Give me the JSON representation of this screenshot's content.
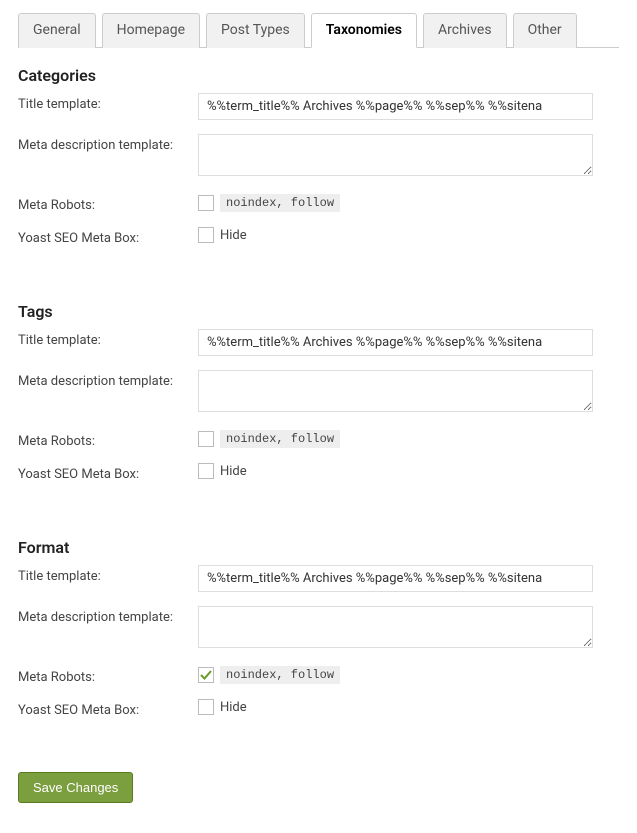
{
  "tabs": {
    "general": "General",
    "homepage": "Homepage",
    "post_types": "Post Types",
    "taxonomies": "Taxonomies",
    "archives": "Archives",
    "other": "Other"
  },
  "labels": {
    "title_template": "Title template:",
    "meta_description_template": "Meta description template:",
    "meta_robots": "Meta Robots:",
    "yoast_meta_box": "Yoast SEO Meta Box:",
    "noindex_follow": "noindex, follow",
    "hide": "Hide"
  },
  "sections": {
    "categories": {
      "heading": "Categories",
      "title_template": "%%term_title%% Archives %%page%% %%sep%% %%sitena",
      "meta_description": "",
      "meta_robots_checked": false,
      "hide_checked": false
    },
    "tags": {
      "heading": "Tags",
      "title_template": "%%term_title%% Archives %%page%% %%sep%% %%sitena",
      "meta_description": "",
      "meta_robots_checked": false,
      "hide_checked": false
    },
    "format": {
      "heading": "Format",
      "title_template": "%%term_title%% Archives %%page%% %%sep%% %%sitena",
      "meta_description": "",
      "meta_robots_checked": true,
      "hide_checked": false
    }
  },
  "buttons": {
    "save": "Save Changes"
  }
}
